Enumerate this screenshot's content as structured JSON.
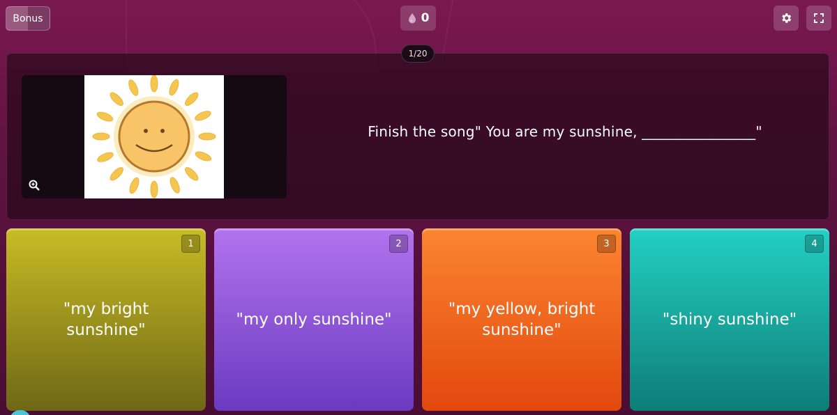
{
  "header": {
    "bonus_label": "Bonus",
    "points_value": "0",
    "settings_icon": "gear-icon",
    "fullscreen_icon": "fullscreen-icon",
    "points_icon": "drop-icon"
  },
  "question": {
    "progress": "1/20",
    "text": "Finish the song\" You are my sunshine, ________________\"",
    "image_name": "smiling-sun-image",
    "zoom_icon": "zoom-in-icon"
  },
  "answers": [
    {
      "number": "1",
      "text": "\"my bright sunshine\"",
      "color": "#c7bc25"
    },
    {
      "number": "2",
      "text": "\"my only sunshine\"",
      "color": "#b373ee"
    },
    {
      "number": "3",
      "text": "\"my yellow, bright sunshine\"",
      "color": "#fb8530"
    },
    {
      "number": "4",
      "text": "\"shiny sunshine\"",
      "color": "#24d0c3"
    }
  ],
  "colors": {
    "background": "#6a1446",
    "panel": "#28081c"
  }
}
